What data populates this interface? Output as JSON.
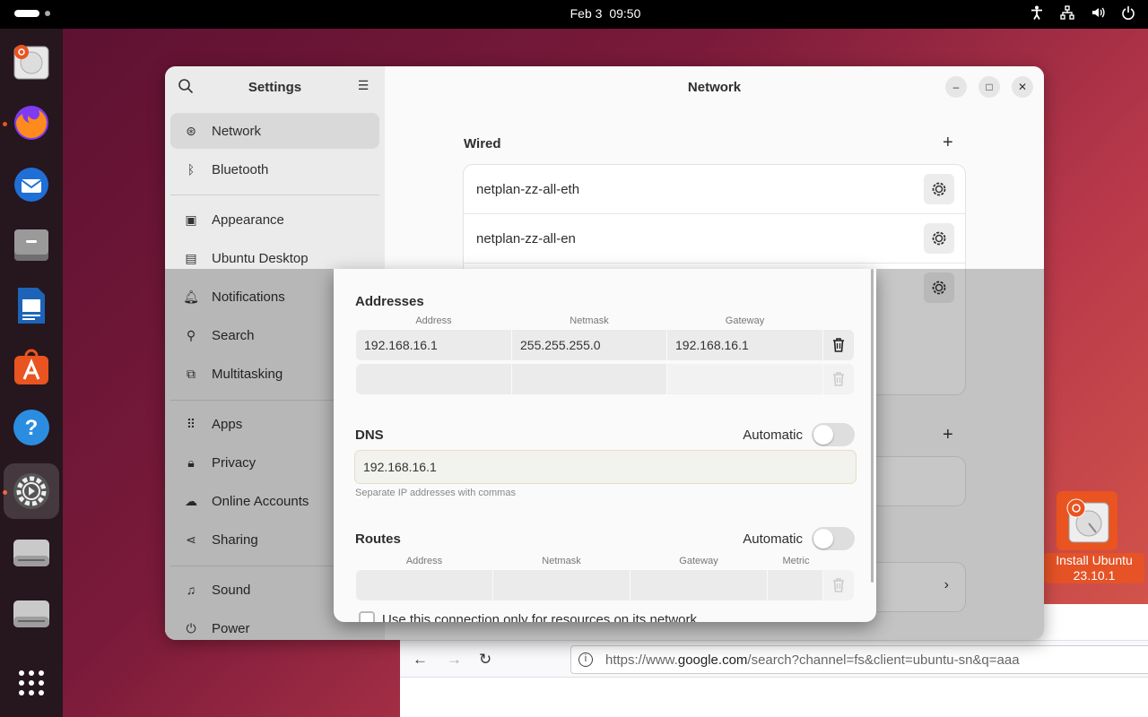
{
  "topbar": {
    "date": "Feb 3",
    "time": "09:50",
    "tray": [
      "accessibility-icon",
      "network-icon",
      "volume-icon",
      "power-icon"
    ]
  },
  "dock": {
    "items": [
      "ubuntu-installer",
      "firefox",
      "thunderbird",
      "files",
      "libreoffice-writer",
      "app-center",
      "help",
      "settings",
      "disk-drive",
      "disk-drive",
      "show-apps-grid"
    ]
  },
  "settings": {
    "sidebar_title": "Settings",
    "items": [
      {
        "label": "Network",
        "icon": "network-icon"
      },
      {
        "label": "Bluetooth",
        "icon": "bluetooth-icon"
      },
      {
        "label": "Appearance",
        "icon": "appearance-icon"
      },
      {
        "label": "Ubuntu Desktop",
        "icon": "desktop-icon"
      },
      {
        "label": "Notifications",
        "icon": "bell-icon"
      },
      {
        "label": "Search",
        "icon": "search-icon"
      },
      {
        "label": "Multitasking",
        "icon": "multitasking-icon"
      },
      {
        "label": "Apps",
        "icon": "apps-icon"
      },
      {
        "label": "Privacy",
        "icon": "lock-icon"
      },
      {
        "label": "Online Accounts",
        "icon": "cloud-icon"
      },
      {
        "label": "Sharing",
        "icon": "share-icon"
      },
      {
        "label": "Sound",
        "icon": "music-note-icon"
      },
      {
        "label": "Power",
        "icon": "power-icon"
      }
    ],
    "page_title": "Network",
    "wired_title": "Wired",
    "connections": [
      "netplan-zz-all-eth",
      "netplan-zz-all-en"
    ]
  },
  "dialog": {
    "addresses_title": "Addresses",
    "addr_headers": [
      "Address",
      "Netmask",
      "Gateway"
    ],
    "addr_rows": [
      [
        "192.168.16.1",
        "255.255.255.0",
        "192.168.16.1"
      ],
      [
        "",
        "",
        ""
      ]
    ],
    "dns_title": "DNS",
    "automatic_label": "Automatic",
    "dns_value": "192.168.16.1",
    "dns_hint": "Separate IP addresses with commas",
    "routes_title": "Routes",
    "route_headers": [
      "Address",
      "Netmask",
      "Gateway",
      "Metric"
    ],
    "checkbox_label": "Use this connection only for resources on its network"
  },
  "browser": {
    "url_prefix": "https://www.",
    "url_host": "google.com",
    "url_path": "/search?channel=fs&client=ubuntu-sn&q=aaa"
  },
  "desktop_icon": {
    "label_line1": "Install Ubuntu",
    "label_line2": "23.10.1"
  },
  "colors": {
    "accent": "#e95420",
    "wallpaper_dark": "#5a1030",
    "wallpaper_light": "#d85a4a"
  }
}
